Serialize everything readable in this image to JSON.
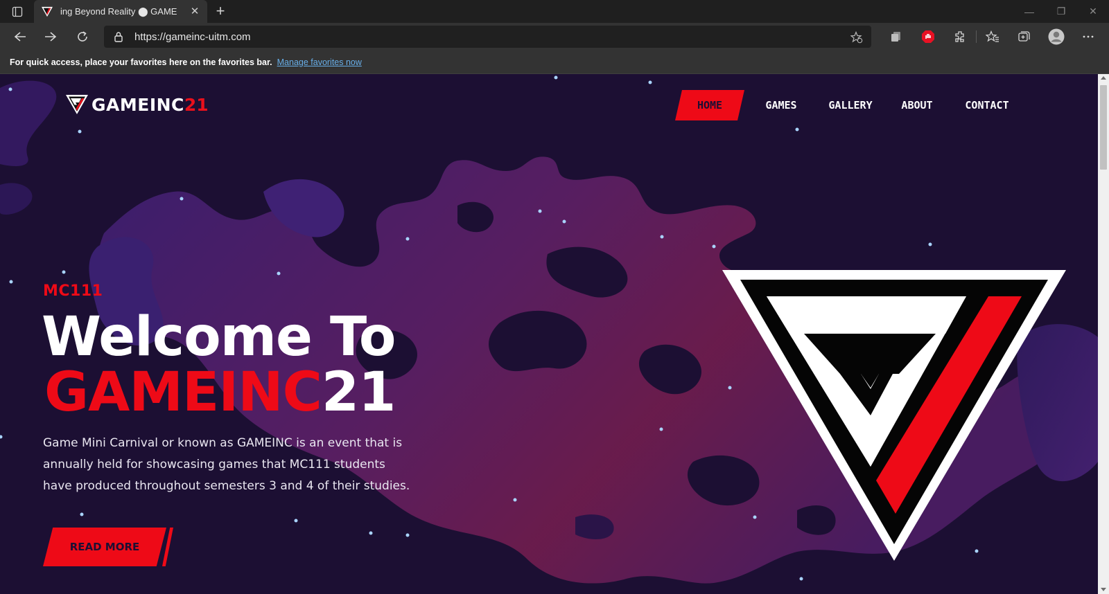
{
  "browser": {
    "tab_title": "ing Beyond Reality ⬤ GAME",
    "url": "https://gameinc-uitm.com",
    "favorites_message": "For quick access, place your favorites here on the favorites bar.",
    "favorites_link": "Manage favorites now"
  },
  "site": {
    "logo_text": "GAMEINC",
    "logo_number": "21",
    "nav": [
      "HOME",
      "GAMES",
      "GALLERY",
      "ABOUT",
      "CONTACT"
    ],
    "active_nav": "HOME"
  },
  "hero": {
    "kicker": "MC111",
    "headline_line1": "Welcome To",
    "headline_red": "GAMEINC",
    "headline_white": "21",
    "description": "Game Mini Carnival or known as GAMEINC is an event that is annually held for showcasing games that MC111 students have produced throughout semesters 3 and 4 of their studies.",
    "cta_label": "READ MORE"
  },
  "colors": {
    "accent_red": "#ee0a17",
    "background": "#1c0f33",
    "blob_magenta": "#6b1f52",
    "blob_purple": "#3a1f6e"
  }
}
